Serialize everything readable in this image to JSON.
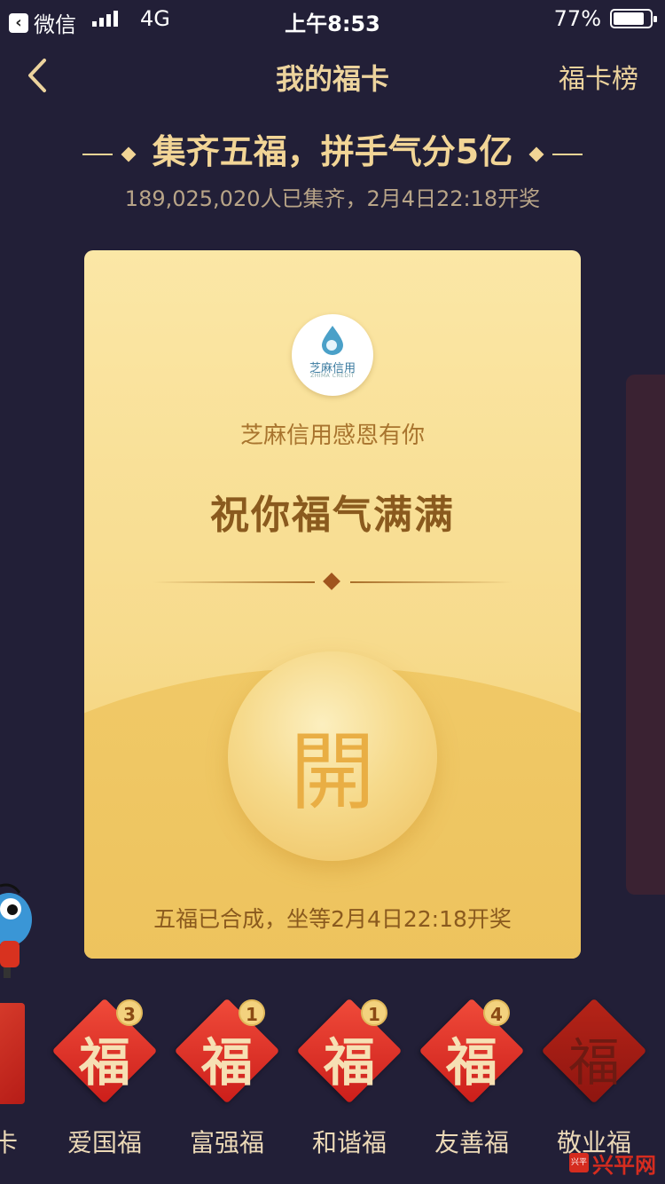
{
  "status_bar": {
    "back_app": "微信",
    "network": "4G",
    "time": "上午8:53",
    "battery_pct": "77%",
    "battery_level": 0.77
  },
  "nav": {
    "title": "我的福卡",
    "right_action": "福卡榜"
  },
  "headline": {
    "title": "集齐五福，拼手气分5亿",
    "subtitle": "189,025,020人已集齐，2月4日22:18开奖"
  },
  "card": {
    "logo_cn": "芝麻信用",
    "logo_en": "ZHIMA CREDIT",
    "thanks": "芝麻信用感恩有你",
    "blessing": "祝你福气满满",
    "open_glyph": "開",
    "waiting_text": "五福已合成，坐等2月4日22:18开奖"
  },
  "fu_cards": {
    "edge_label": "卡",
    "items": [
      {
        "char": "福",
        "label": "爱国福",
        "count": "3"
      },
      {
        "char": "福",
        "label": "富强福",
        "count": "1"
      },
      {
        "char": "福",
        "label": "和谐福",
        "count": "1"
      },
      {
        "char": "福",
        "label": "友善福",
        "count": "4"
      },
      {
        "char": "福",
        "label": "敬业福",
        "count": ""
      }
    ]
  },
  "watermark": {
    "icon_text": "兴平",
    "text": "兴平网"
  },
  "colors": {
    "background": "#221f37",
    "gold": "#ecd39d",
    "card": "#f7db8d",
    "red": "#cc1e1a"
  }
}
